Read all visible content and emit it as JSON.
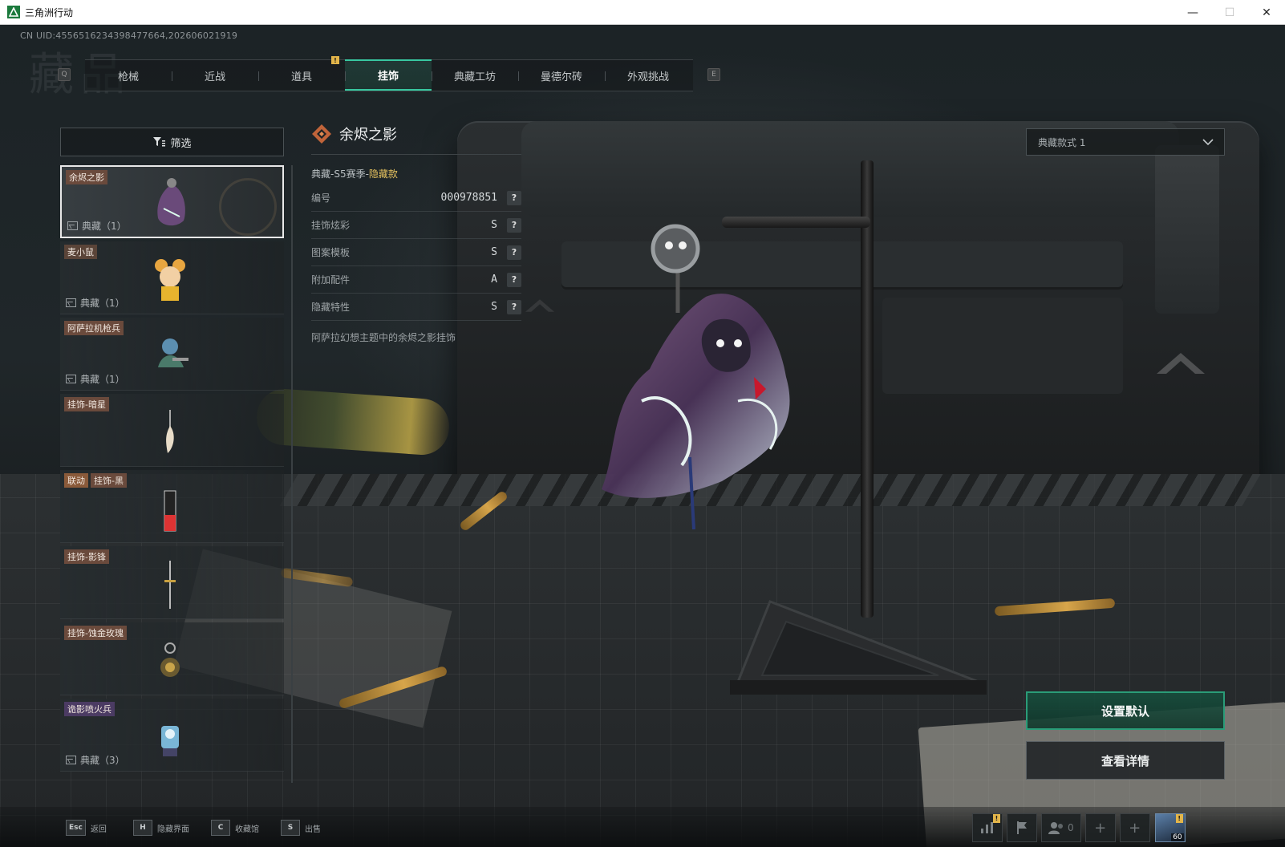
{
  "window": {
    "title": "三角洲行动",
    "controls": {
      "minimize": "—",
      "maximize": "☐",
      "close": "✕"
    }
  },
  "header": {
    "uid": "CN UID:4556516234398477664,202606021919",
    "watermark": "藏品"
  },
  "tabs": {
    "prev_key": "Q",
    "next_key": "E",
    "items": [
      {
        "label": "枪械",
        "active": false
      },
      {
        "label": "近战",
        "active": false
      },
      {
        "label": "道具",
        "active": false
      },
      {
        "label": "挂饰",
        "active": true
      },
      {
        "label": "典藏工坊",
        "active": false
      },
      {
        "label": "曼德尔砖",
        "active": false
      },
      {
        "label": "外观挑战",
        "active": false
      }
    ],
    "badge": "!"
  },
  "filter": {
    "label": "筛选"
  },
  "list": {
    "items": [
      {
        "tags": [
          "余烬之影"
        ],
        "count": "典藏（1）",
        "selected": true
      },
      {
        "tags": [
          "麦小鼠"
        ],
        "count": "典藏（1）",
        "selected": false
      },
      {
        "tags": [
          "阿萨拉机枪兵"
        ],
        "count": "典藏（1）",
        "selected": false
      },
      {
        "tags": [
          "挂饰-暗星"
        ],
        "count": "",
        "selected": false
      },
      {
        "tags": [
          "联动",
          "挂饰-黑"
        ],
        "count": "",
        "selected": false
      },
      {
        "tags": [
          "挂饰-影锋"
        ],
        "count": "",
        "selected": false
      },
      {
        "tags": [
          "挂饰-蚀金玫瑰"
        ],
        "count": "",
        "selected": false
      },
      {
        "tags": [
          "诡影喷火兵"
        ],
        "count": "典藏（3）",
        "selected": false
      }
    ]
  },
  "detail": {
    "name": "余烬之影",
    "series_prefix": "典藏-S5赛季-",
    "series_hidden": "隐藏款",
    "attributes": [
      {
        "label": "编号",
        "value": "000978851"
      },
      {
        "label": "挂饰炫彩",
        "value": "S"
      },
      {
        "label": "图案模板",
        "value": "S"
      },
      {
        "label": "附加配件",
        "value": "A"
      },
      {
        "label": "隐藏特性",
        "value": "S"
      }
    ],
    "help": "?",
    "description": "阿萨拉幻想主题中的余烬之影挂饰"
  },
  "style_select": {
    "value": "典藏款式 1"
  },
  "actions": {
    "set_default": "设置默认",
    "view_details": "查看详情"
  },
  "bottom": {
    "hints": [
      {
        "key": "Esc",
        "label": "返回"
      },
      {
        "key": "H",
        "label": "隐藏界面"
      },
      {
        "key": "C",
        "label": "收藏馆"
      },
      {
        "key": "S",
        "label": "出售"
      }
    ],
    "friends_count": "0",
    "plus": "+",
    "badge": "!",
    "avatar_level": "60"
  },
  "colors": {
    "accent": "#38c7a0",
    "hidden_label": "#e5c15e",
    "tag_bg": "#6a4a3c"
  }
}
